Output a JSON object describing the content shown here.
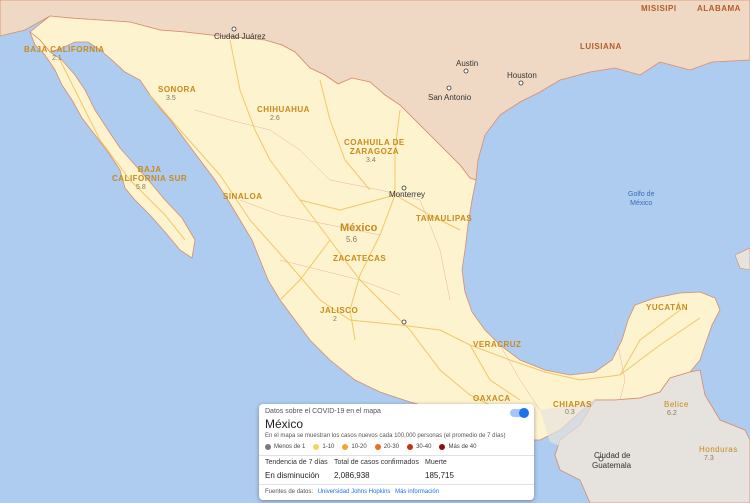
{
  "card": {
    "header": "Datos sobre el COVID-19 en el mapa",
    "country": "México",
    "description": "En el mapa se muestran los casos nuevos cada 100,000 personas (el promedio de 7 días)",
    "legend": [
      {
        "label": "Menos de 1",
        "color": "#7a7a7a"
      },
      {
        "label": "1-10",
        "color": "#f5d65a"
      },
      {
        "label": "10-20",
        "color": "#f2a72b"
      },
      {
        "label": "20-30",
        "color": "#e8701e"
      },
      {
        "label": "30-40",
        "color": "#c8321b"
      },
      {
        "label": "Más de 40",
        "color": "#8c1210"
      }
    ],
    "stats": [
      {
        "label": "Tendencia de 7 días",
        "value": "En disminución"
      },
      {
        "label": "Total de casos confirmados",
        "value": "2,086,938"
      },
      {
        "label": "Muerte",
        "value": "185,715"
      }
    ],
    "sources_label": "Fuentes de datos:",
    "sources_link": "Universidad Johns Hopkins",
    "more_info": "Más información"
  },
  "map": {
    "country_label": "México",
    "country_value": "5.6",
    "states": [
      {
        "name": "BAJA CALIFORNIA",
        "value": "2.1"
      },
      {
        "name": "SONORA",
        "value": "3.5"
      },
      {
        "name": "CHIHUAHUA",
        "value": "2.6"
      },
      {
        "name": "COAHUILA DE",
        "name2": "ZARAGOZA",
        "value": "3.4"
      },
      {
        "name": "BAJA",
        "name2": "CALIFORNIA SUR",
        "value": "5.8"
      },
      {
        "name": "SINALOA",
        "value": ""
      },
      {
        "name": "TAMAULIPAS",
        "value": ""
      },
      {
        "name": "ZACATECAS",
        "value": ""
      },
      {
        "name": "JALISCO",
        "value": "2"
      },
      {
        "name": "VERACRUZ",
        "value": ""
      },
      {
        "name": "OAXACA",
        "value": ""
      },
      {
        "name": "CHIAPAS",
        "value": "0.3"
      },
      {
        "name": "YUCATÁN",
        "value": ""
      }
    ],
    "us_states": [
      "MISISIPI",
      "ALABAMA",
      "LUISIANA"
    ],
    "neighbors": [
      {
        "name": "Belice",
        "value": "6.2"
      },
      {
        "name": "Honduras",
        "value": "7.3"
      }
    ],
    "cities": [
      "Ciudad Juárez",
      "Austin",
      "Houston",
      "San Antonio",
      "Monterrey",
      "Ciudad de",
      "Guatemala"
    ],
    "water": {
      "line1": "Golfo de",
      "line2": "México"
    },
    "colors": {
      "sea": "#aecbf0",
      "mexico": "#fdf3cf",
      "us": "#f0d9c4",
      "central_america": "#e6e2dd",
      "roads": "#f2c867",
      "borders": "#d98c6a"
    }
  }
}
